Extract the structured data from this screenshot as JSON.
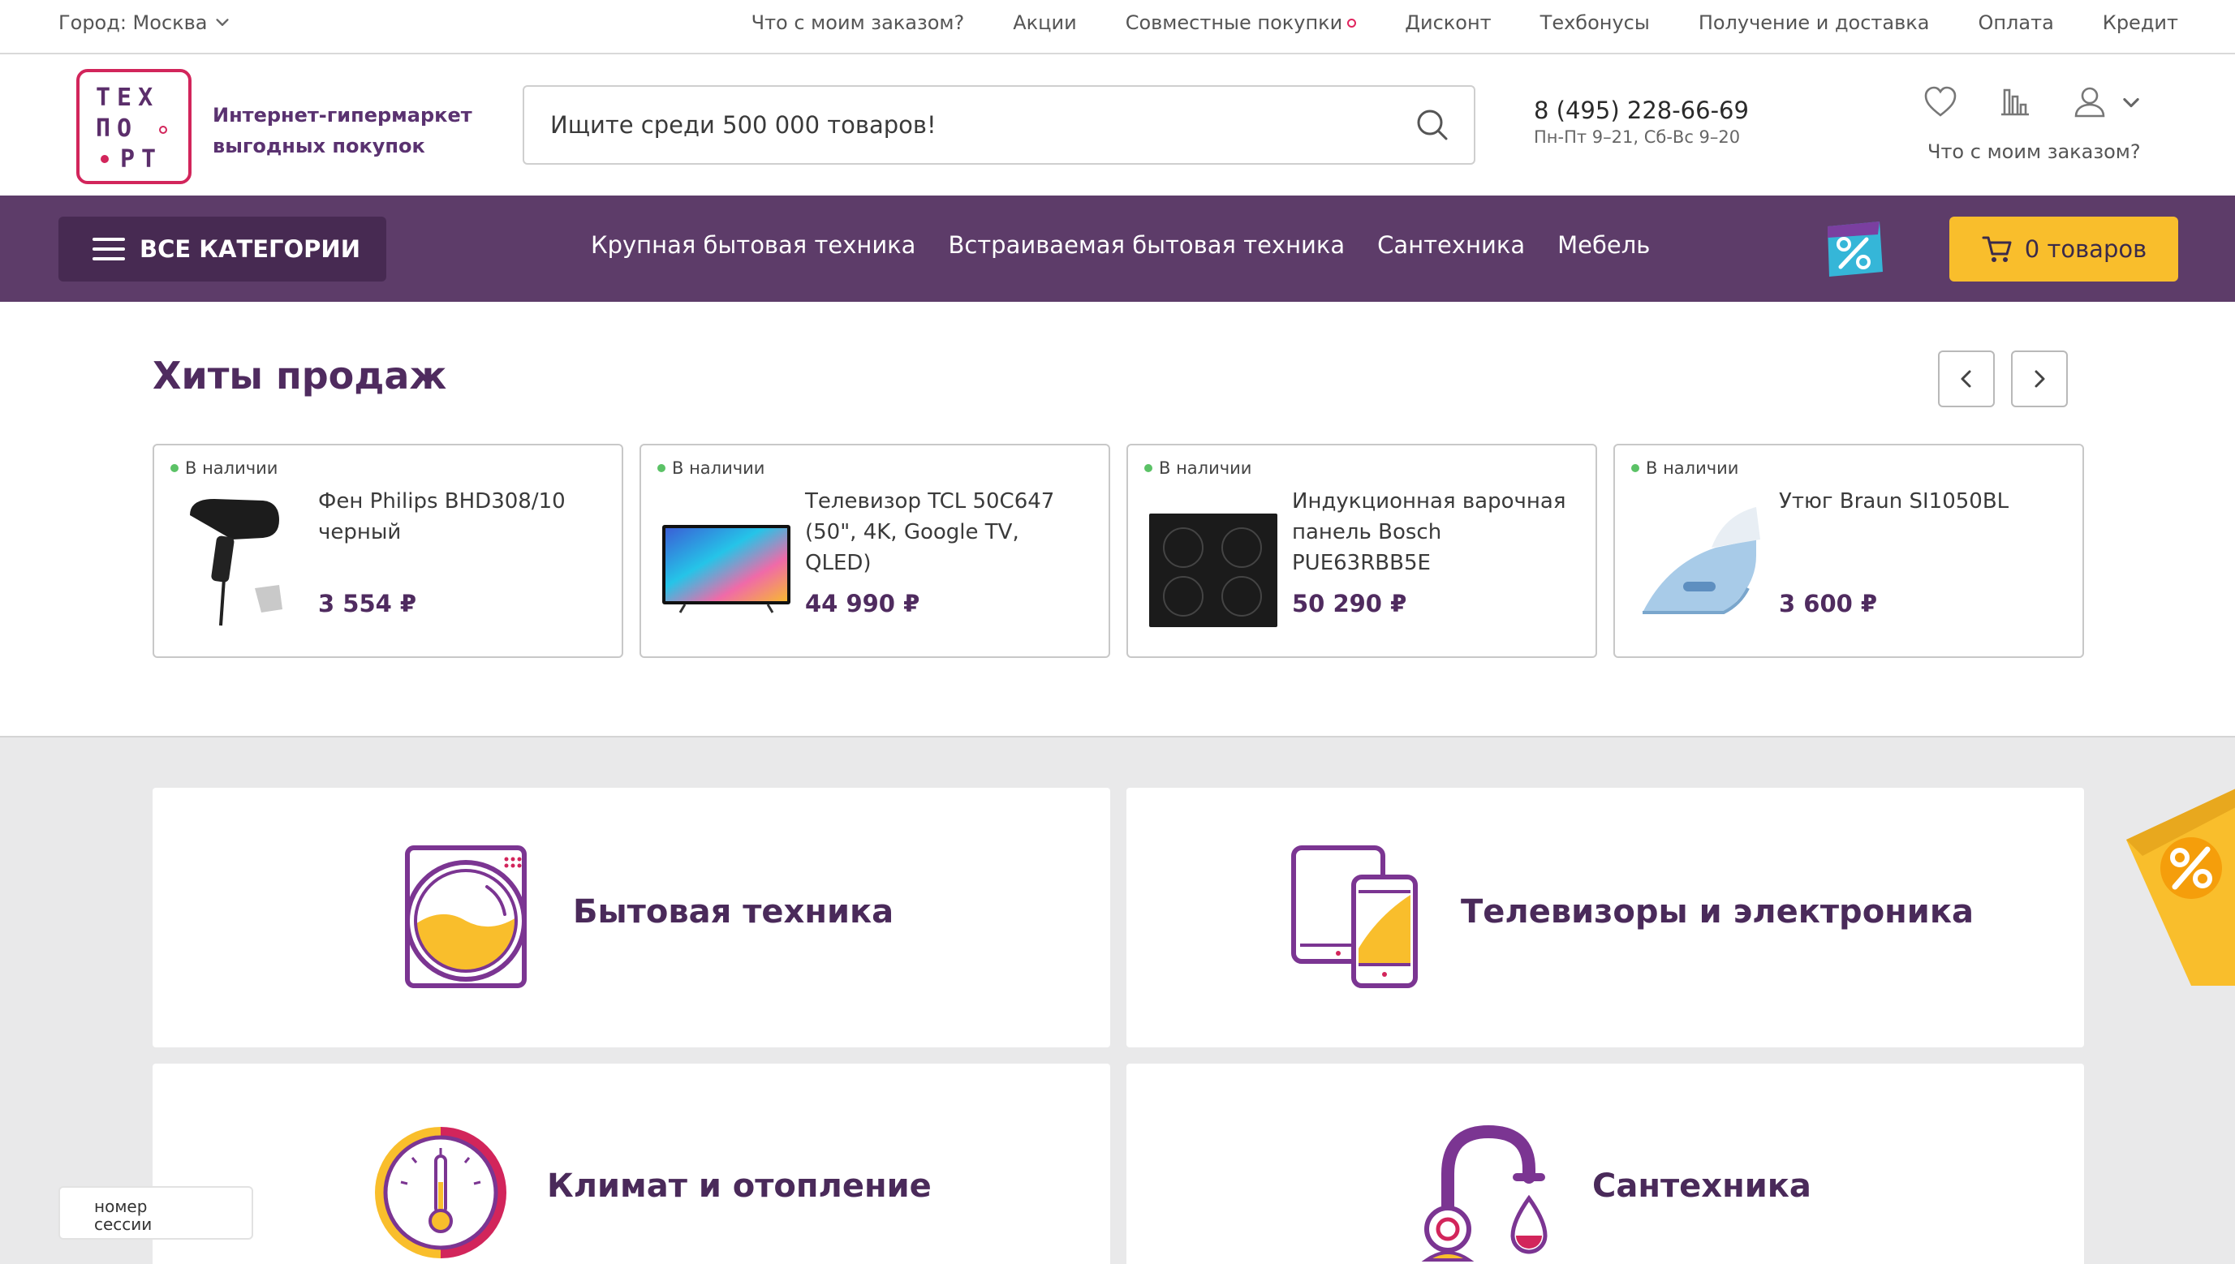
{
  "topbar": {
    "city": "Город: Москва",
    "links": [
      "Что с моим заказом?",
      "Акции",
      "Совместные покупки",
      "Дисконт",
      "Техбонусы",
      "Получение и доставка",
      "Оплата",
      "Кредит"
    ]
  },
  "header": {
    "logo_letters": [
      "ТЕХ",
      "ПО",
      "РТ"
    ],
    "tagline_1": "Интернет-гипермаркет",
    "tagline_2": "выгодных покупок",
    "search_placeholder": "Ищите среди 500 000 товаров!",
    "phone": "8 (495) 228-66-69",
    "hours": "Пн-Пт 9–21, Сб-Вс 9–20",
    "order_link": "Что с моим заказом?"
  },
  "catbar": {
    "all_categories": "ВСЕ КАТЕГОРИИ",
    "links": [
      "Крупная бытовая техника",
      "Встраиваемая бытовая техника",
      "Сантехника",
      "Мебель"
    ],
    "cart_label": "0 товаров"
  },
  "hits": {
    "title": "Хиты продаж",
    "products": [
      {
        "stock": "В наличии",
        "name": "Фен Philips BHD308/10 черный",
        "price": "3 554 ₽",
        "icon": "hair-dryer"
      },
      {
        "stock": "В наличии",
        "name": "Телевизор TCL 50C647 (50\", 4K, Google TV, QLED)",
        "price": "44 990 ₽",
        "icon": "tv"
      },
      {
        "stock": "В наличии",
        "name": "Индукционная варочная панель Bosch PUE63RBB5E",
        "price": "50 290 ₽",
        "icon": "cooktop"
      },
      {
        "stock": "В наличии",
        "name": "Утюг Braun SI1050BL",
        "price": "3 600 ₽",
        "icon": "iron"
      }
    ]
  },
  "categories": [
    {
      "label": "Бытовая техника",
      "icon": "washing-machine"
    },
    {
      "label": "Телевизоры и электроника",
      "icon": "devices"
    },
    {
      "label": "Климат и отопление",
      "icon": "thermometer-gauge"
    },
    {
      "label": "Сантехника",
      "icon": "faucet"
    }
  ],
  "session": {
    "line1": "номер",
    "line2": "сессии"
  },
  "colors": {
    "brand_purple": "#5d3c69",
    "accent_yellow": "#f9be2c",
    "logo_red": "#d2255b",
    "in_stock_green": "#5bc266"
  }
}
